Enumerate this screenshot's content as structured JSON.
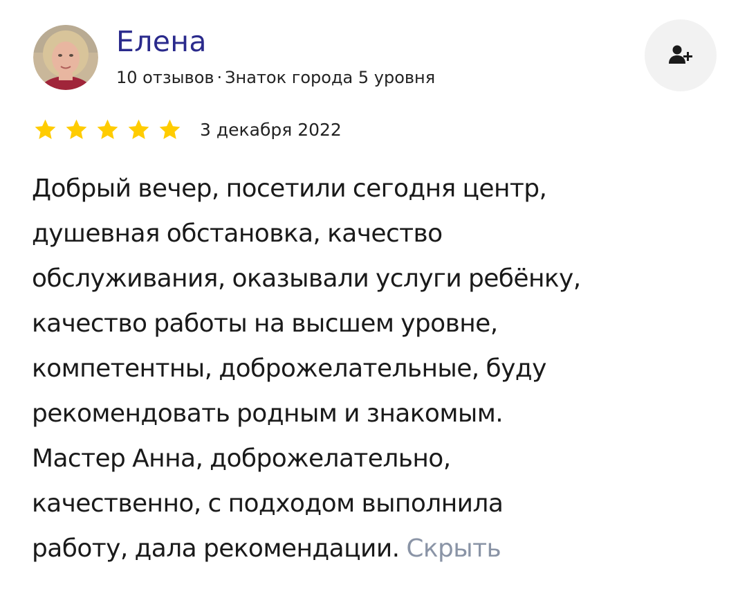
{
  "author": {
    "name": "Елена",
    "reviews_count": "10 отзывов",
    "separator": "·",
    "badge": "Знаток города 5 уровня"
  },
  "subscribe_button": {
    "icon": "add-user-icon"
  },
  "rating": {
    "stars": 5,
    "max": 5,
    "star_color": "#ffcc00",
    "date": "3 декабря 2022"
  },
  "review": {
    "lines": [
      "Добрый вечер, посетили сегодня центр,",
      "душевная обстановка, качество",
      "обслуживания, оказывали услуги ребёнку,",
      "качество работы на высшем уровне,",
      "компетентны, доброжелательные, буду",
      "рекомендовать родным и знакомым.",
      "Мастер Анна, доброжелательно,",
      "качественно, с подходом выполнила",
      "работу, дала рекомендации."
    ],
    "hide_label": "Скрыть"
  },
  "colors": {
    "author_name": "#2a2a8c",
    "link_muted": "#8a94a6",
    "button_bg": "#f2f2f2"
  }
}
